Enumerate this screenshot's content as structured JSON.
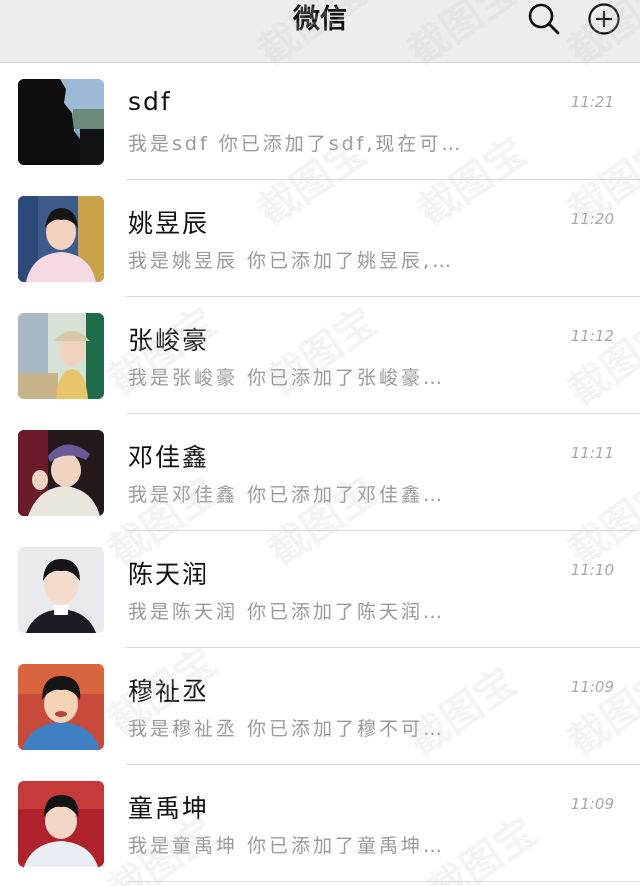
{
  "header": {
    "title": "微信",
    "search_icon": "search-icon",
    "add_icon": "plus-circle-icon"
  },
  "watermark_text": "截图宝",
  "chats": [
    {
      "name": "sdf",
      "preview": "我是sdf 你已添加了sdf,现在可…",
      "time": "11:21"
    },
    {
      "name": "姚昱辰",
      "preview": "我是姚昱辰 你已添加了姚昱辰,…",
      "time": "11:20"
    },
    {
      "name": "张峻豪",
      "preview": "我是张峻豪 你已添加了张峻豪…",
      "time": "11:12"
    },
    {
      "name": "邓佳鑫",
      "preview": "我是邓佳鑫 你已添加了邓佳鑫…",
      "time": "11:11"
    },
    {
      "name": "陈天润",
      "preview": "我是陈天润 你已添加了陈天润…",
      "time": "11:10"
    },
    {
      "name": "穆祉丞",
      "preview": "我是穆祉丞 你已添加了穆不可…",
      "time": "11:09"
    },
    {
      "name": "童禹坤",
      "preview": "我是童禹坤 你已添加了童禹坤…",
      "time": "11:09"
    }
  ]
}
